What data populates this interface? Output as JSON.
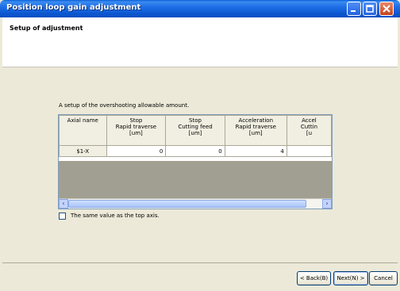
{
  "window": {
    "title": "Position loop gain adjustment"
  },
  "header": {
    "heading": "Setup of adjustment"
  },
  "content": {
    "caption": "A setup of the overshooting allowable amount.",
    "table": {
      "columns": [
        "Axial name",
        "Stop\nRapid traverse\n[um]",
        "Stop\nCutting feed\n[um]",
        "Acceleration\nRapid traverse\n[um]",
        "Accel\nCuttin\n[u"
      ],
      "rows": [
        [
          "$1-X",
          "0",
          "0",
          "4",
          ""
        ]
      ]
    },
    "checkbox": {
      "label": "The same value as the top axis.",
      "checked": false
    }
  },
  "buttons": {
    "back": "< Back(B)",
    "next": "Next(N) >",
    "cancel": "Cancel"
  },
  "colors": {
    "titlebar": "#0b56cf",
    "window_bg": "#ece9d8",
    "grid_empty": "#a19f91"
  }
}
